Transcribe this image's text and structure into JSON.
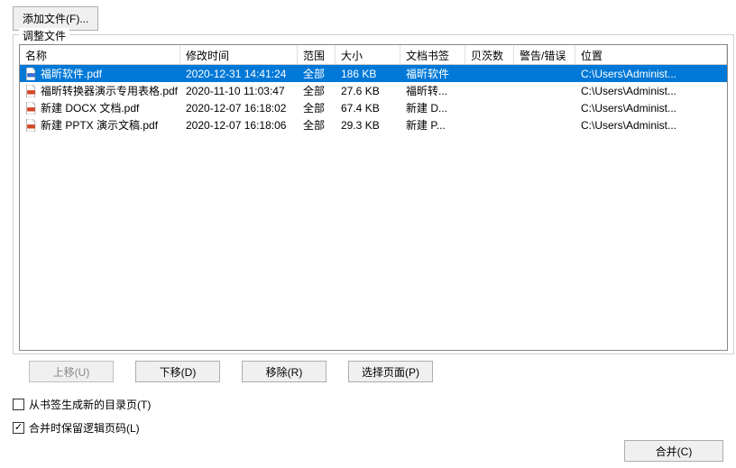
{
  "buttons": {
    "add_file": "添加文件(F)...",
    "move_up": "上移(U)",
    "move_down": "下移(D)",
    "remove": "移除(R)",
    "select_pages": "选择页面(P)",
    "merge": "合并(C)"
  },
  "groupbox_title": "调整文件",
  "columns": {
    "name": "名称",
    "mtime": "修改时间",
    "scope": "范围",
    "size": "大小",
    "bookmark": "文档书签",
    "bates": "贝茨数",
    "warn": "警告/错误",
    "location": "位置"
  },
  "rows": [
    {
      "name": "福昕软件.pdf",
      "mtime": "2020-12-31 14:41:24",
      "scope": "全部",
      "size": "186 KB",
      "bookmark": "福昕软件",
      "bates": "",
      "warn": "",
      "location": "C:\\Users\\Administ...",
      "selected": true,
      "icon": "blue"
    },
    {
      "name": "福昕转换器演示专用表格.pdf",
      "mtime": "2020-11-10 11:03:47",
      "scope": "全部",
      "size": "27.6 KB",
      "bookmark": "福昕转...",
      "bates": "",
      "warn": "",
      "location": "C:\\Users\\Administ...",
      "selected": false,
      "icon": "red"
    },
    {
      "name": "新建 DOCX 文档.pdf",
      "mtime": "2020-12-07 16:18:02",
      "scope": "全部",
      "size": "67.4 KB",
      "bookmark": "新建 D...",
      "bates": "",
      "warn": "",
      "location": "C:\\Users\\Administ...",
      "selected": false,
      "icon": "red"
    },
    {
      "name": "新建 PPTX 演示文稿.pdf",
      "mtime": "2020-12-07 16:18:06",
      "scope": "全部",
      "size": "29.3 KB",
      "bookmark": "新建 P...",
      "bates": "",
      "warn": "",
      "location": "C:\\Users\\Administ...",
      "selected": false,
      "icon": "red"
    }
  ],
  "checkboxes": {
    "generate_toc": {
      "label": "从书签生成新的目录页(T)",
      "checked": false
    },
    "preserve_logical_pages": {
      "label": "合并时保留逻辑页码(L)",
      "checked": true
    }
  }
}
